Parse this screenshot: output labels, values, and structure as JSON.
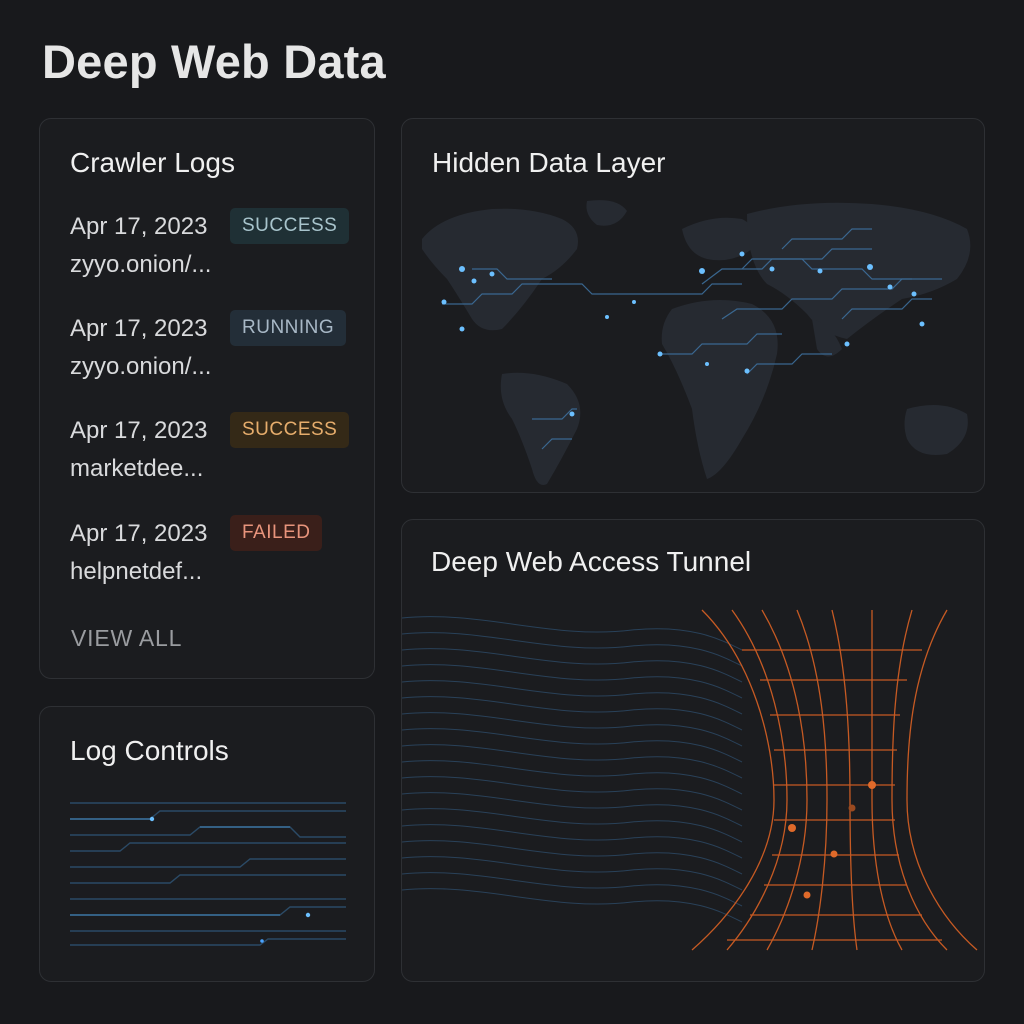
{
  "page": {
    "title": "Deep Web Data"
  },
  "crawler_logs": {
    "title": "Crawler Logs",
    "entries": [
      {
        "date": "Apr 17, 2023",
        "status": "SUCCESS",
        "url": "zyyo.onion/..."
      },
      {
        "date": "Apr 17, 2023",
        "status": "RUNNING",
        "url": "zyyo.onion/..."
      },
      {
        "date": "Apr 17, 2023",
        "status": "SUCCESS",
        "url": "marketdee..."
      },
      {
        "date": "Apr 17, 2023",
        "status": "FAILED",
        "url": "helpnetdef..."
      }
    ],
    "view_all": "VIEW ALL"
  },
  "log_controls": {
    "title": "Log Controls"
  },
  "hidden_data_layer": {
    "title": "Hidden Data Layer"
  },
  "access_tunnel": {
    "title": "Deep Web Access Tunnel"
  },
  "colors": {
    "background": "#18191c",
    "card": "#1b1c1f",
    "accent_blue": "#4aa3ff",
    "accent_orange": "#e06a2a",
    "success_teal": "#a8c4cc",
    "success_amber": "#e6ad6c",
    "failed": "#e8947c"
  }
}
